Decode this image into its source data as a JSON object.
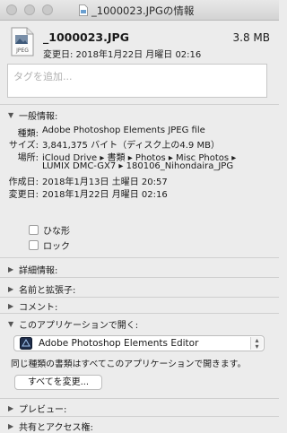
{
  "window": {
    "title": "_1000023.JPGの情報"
  },
  "header": {
    "file_name": "_1000023.JPG",
    "file_size": "3.8 MB",
    "modified": "変更日: 2018年1月22日 月曜日 02:16",
    "file_icon_label": "JPEG"
  },
  "tags": {
    "placeholder": "タグを追加..."
  },
  "general": {
    "title": "一般情報:",
    "rows": [
      {
        "key": "種類:",
        "value": "Adobe Photoshop Elements JPEG file"
      },
      {
        "key": "サイズ:",
        "value": "3,841,375 バイト（ディスク上の4.9 MB）"
      },
      {
        "key": "場所:",
        "value": "iCloud Drive ▸ 書類 ▸ Photos ▸ Misc Photos ▸"
      },
      {
        "key": "",
        "value": "LUMIX DMC-GX7 ▸ 180106_Nihondaira_JPG"
      },
      {
        "key": "作成日:",
        "value": "2018年1月13日 土曜日 20:57"
      },
      {
        "key": "変更日:",
        "value": "2018年1月22日 月曜日 02:16"
      }
    ],
    "stationery_label": "ひな形",
    "locked_label": "ロック"
  },
  "sections": {
    "more_info": "詳細情報:",
    "name_ext": "名前と拡張子:",
    "comments": "コメント:",
    "open_with": "このアプリケーションで開く:",
    "preview": "プレビュー:",
    "sharing": "共有とアクセス権:"
  },
  "open_with": {
    "app_name": "Adobe Photoshop Elements Editor",
    "note": "同じ種類の書類はすべてこのアプリケーションで開きます。",
    "change_all_label": "すべてを変更..."
  }
}
